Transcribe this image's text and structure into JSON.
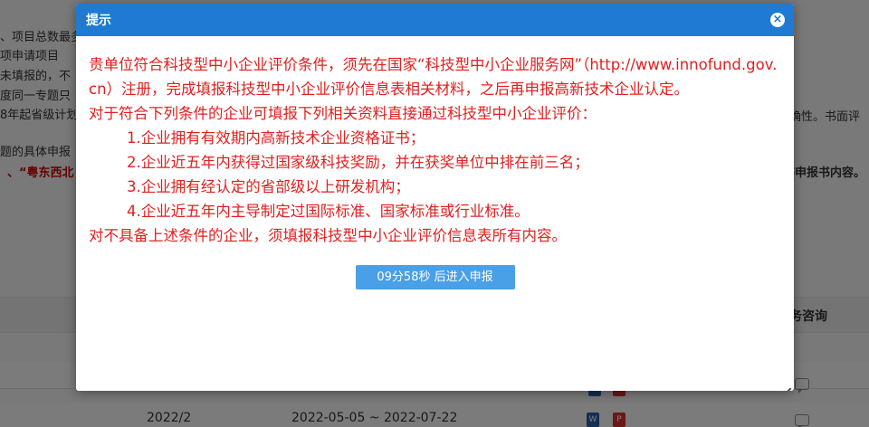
{
  "background": {
    "lines": [
      "、项目总数最多",
      "项申请项目",
      "未填报的，不",
      "度同一专题只",
      "8年起省级计划",
      "题的具体申报"
    ],
    "red_line": "、“粤东西北",
    "right_text_1": "确性。书面评",
    "right_text_2": "书申报书内容。",
    "table_header_right": "务咨询",
    "last_row": {
      "year": "2022/2",
      "date_range": "2022-05-05 ~ 2022-07-22"
    }
  },
  "dialog": {
    "title": "提示",
    "close_icon": "×",
    "paragraph_1": "贵单位符合科技型中小企业评价条件，须先在国家“科技型中小企业服务网”（http://www.innofund.gov.cn）注册，完成填报科技型中小企业评价信息表相关材料，之后再申报高新技术企业认定。",
    "paragraph_2": "对于符合下列条件的企业可填报下列相关资料直接通过科技型中小企业评价：",
    "conditions": [
      "1.企业拥有有效期内高新技术企业资格证书；",
      "2.企业近五年内获得过国家级科技奖励，并在获奖单位中排在前三名；",
      "3.企业拥有经认定的省部级以上研发机构；",
      "4.企业近五年内主导制定过国际标准、国家标准或行业标准。"
    ],
    "paragraph_3": "对不具备上述条件的企业，须填报科技型中小企业评价信息表所有内容。",
    "submit_button": "09分58秒 后进入申报"
  },
  "colors": {
    "title_bar": "#1f7ad3",
    "body_text": "#e02020",
    "button": "#4aa0e6"
  }
}
